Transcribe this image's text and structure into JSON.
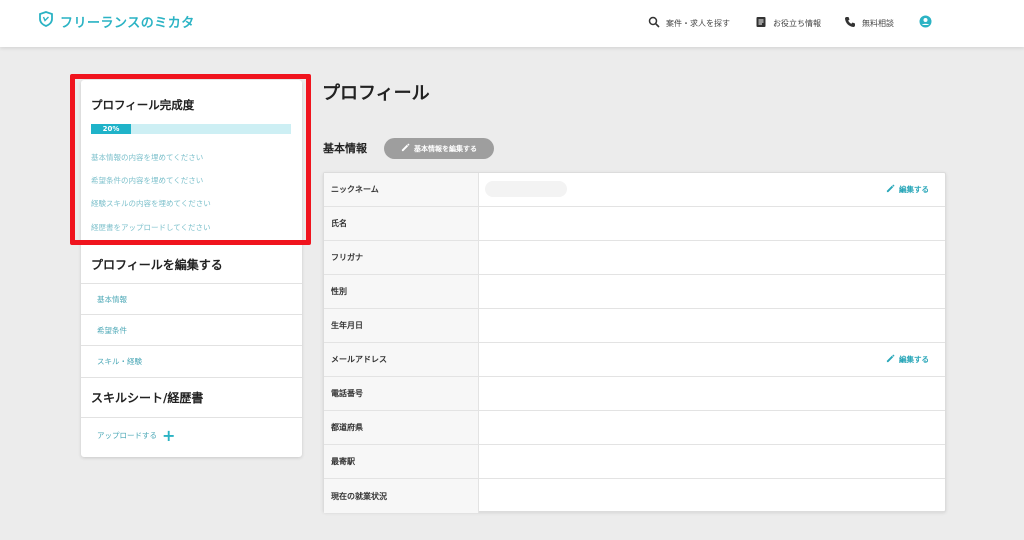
{
  "header": {
    "logo_text": "フリーランスのミカタ",
    "nav": {
      "search_label": "案件・求人を探す",
      "info_label": "お役立ち情報",
      "consult_label": "無料相談"
    }
  },
  "sidebar": {
    "completion": {
      "title": "プロフィール完成度",
      "progress_label": "20%",
      "progress_value": 0.2,
      "todos": [
        "基本情報の内容を埋めてください",
        "希望条件の内容を埋めてください",
        "経験スキルの内容を埋めてください",
        "経歴書をアップロードしてください"
      ]
    },
    "edit_profile": {
      "title": "プロフィールを編集する",
      "links": [
        "基本情報",
        "希望条件",
        "スキル・経験"
      ]
    },
    "skill_sheet": {
      "title": "スキルシート/経歴書",
      "upload_label": "アップロードする"
    }
  },
  "main": {
    "page_title": "プロフィール",
    "section_title": "基本情報",
    "edit_basic_button": "基本情報を編集する",
    "rows": [
      {
        "label": "ニックネーム",
        "edit": "編集する"
      },
      {
        "label": "氏名"
      },
      {
        "label": "フリガナ"
      },
      {
        "label": "性別"
      },
      {
        "label": "生年月日"
      },
      {
        "label": "メールアドレス",
        "edit": "編集する"
      },
      {
        "label": "電話番号"
      },
      {
        "label": "都道府県"
      },
      {
        "label": "最寄駅"
      },
      {
        "label": "現在の就業状況"
      }
    ]
  },
  "colors": {
    "accent": "#2bb3c4",
    "progress_fill": "#1fb3c9",
    "highlight": "#f0141e"
  }
}
